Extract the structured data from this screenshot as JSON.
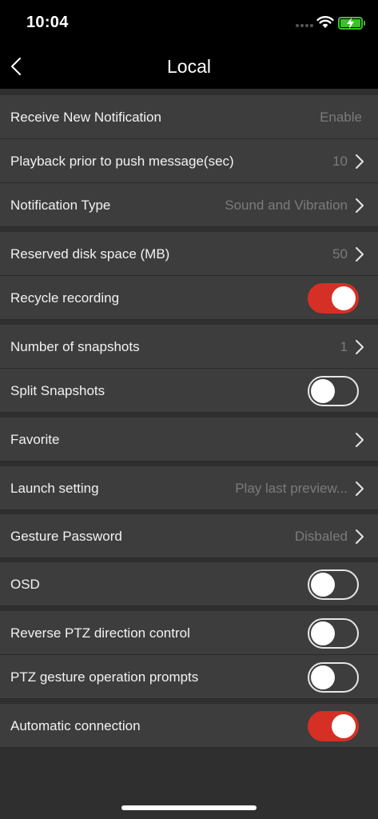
{
  "status_bar": {
    "time": "10:04"
  },
  "nav": {
    "title": "Local",
    "back_icon": "chevron-left-icon"
  },
  "rows": [
    {
      "label": "Receive New Notification",
      "value": "Enable"
    },
    {
      "label": "Playback prior to push message(sec)",
      "value": "10"
    },
    {
      "label": "Notification Type",
      "value": "Sound and Vibration"
    },
    {
      "label": "Reserved disk space (MB)",
      "value": "50"
    },
    {
      "label": "Recycle recording",
      "toggle": true
    },
    {
      "label": "Number of snapshots",
      "value": "1"
    },
    {
      "label": "Split Snapshots",
      "toggle": false
    },
    {
      "label": "Favorite",
      "value": ""
    },
    {
      "label": "Launch setting",
      "value": "Play last preview..."
    },
    {
      "label": "Gesture Password",
      "value": "Disbaled"
    },
    {
      "label": "OSD",
      "toggle": false
    },
    {
      "label": "Reverse PTZ direction control",
      "toggle": false
    },
    {
      "label": "PTZ gesture operation prompts",
      "toggle": false
    },
    {
      "label": "Automatic connection",
      "toggle": true
    }
  ],
  "colors": {
    "accent_toggle_on": "#d62f25",
    "battery": "#3ec02b",
    "row_bg": "#3d3d3d",
    "page_bg": "#2f2f2f"
  }
}
